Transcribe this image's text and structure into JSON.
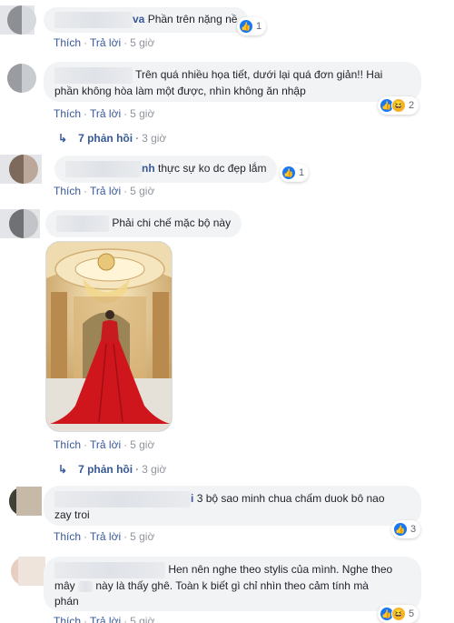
{
  "actions": {
    "like": "Thích",
    "reply": "Trả lời",
    "sep": "·"
  },
  "comments": [
    {
      "name_tail": "va",
      "text": "Phần trên nặng nề",
      "reactions": "1",
      "time": "5 giờ"
    },
    {
      "text_line1": "Trên quá nhiều họa tiết, dưới lại quá đơn giản!! Hai",
      "text_line2": "phần không hòa làm một được, nhìn không ăn nhập",
      "reactions": "2",
      "time": "5 giờ",
      "replies": {
        "label": "7 phản hồi",
        "time": "3 giờ"
      }
    },
    {
      "name_tail": "nh",
      "text": "thực sự ko dc đẹp lắm",
      "reactions": "1",
      "time": "5 giờ"
    },
    {
      "text": "Phải chi chế mặc bộ này",
      "time": "5 giờ",
      "replies": {
        "label": "7 phản hồi",
        "time": "3 giờ"
      }
    },
    {
      "name_tail": "i",
      "text_line1": "3 bộ sao minh chua chấm duok bô nao",
      "text_line2": "zay troi",
      "reactions": "3",
      "time": "5 giờ"
    },
    {
      "text_line1": "Hen nên nghe theo stylis của mình. Nghe theo",
      "text_line2a": "mây ",
      "text_line2b": " này là thấy ghê. Toàn k biết gì chỉ nhìn theo cảm tính mà",
      "text_line3": "phán",
      "reactions": "5",
      "time": "5 giờ"
    }
  ],
  "colors": {
    "link": "#385898",
    "meta": "#90949c",
    "bubble": "#f2f3f5",
    "like": "#1877f2",
    "haha": "#f7b125"
  },
  "icons": [
    "like-icon",
    "haha-icon",
    "reply-arrow-icon"
  ]
}
